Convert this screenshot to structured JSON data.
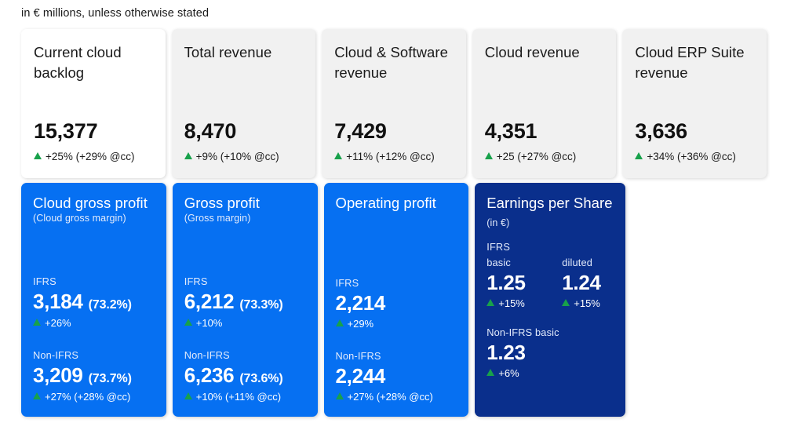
{
  "page": {
    "note": "in € millions, unless otherwise stated"
  },
  "colors": {
    "blue": "#0670f2",
    "navy": "#0a2f8c",
    "grey_card": "#f1f1f1",
    "white_card": "#ffffff",
    "up_green": "#18a14b"
  },
  "icons": {
    "up_triangle": "triangle-up-icon"
  },
  "top_cards": [
    {
      "title": "Current cloud backlog",
      "value": "15,377",
      "delta": "+25% (+29% @cc)",
      "background": "white"
    },
    {
      "title": "Total revenue",
      "value": "8,470",
      "delta": "+9% (+10% @cc)",
      "background": "grey"
    },
    {
      "title": "Cloud & Software revenue",
      "value": "7,429",
      "delta": "+11% (+12% @cc)",
      "background": "grey"
    },
    {
      "title": "Cloud revenue",
      "value": "4,351",
      "delta": "+25 (+27% @cc)",
      "background": "grey"
    },
    {
      "title": "Cloud ERP Suite revenue",
      "value": "3,636",
      "delta": "+34% (+36% @cc)",
      "background": "grey"
    }
  ],
  "bottom_cards": [
    {
      "title": "Cloud gross profit",
      "subtitle": "(Cloud gross margin)",
      "ifrs_label": "IFRS",
      "ifrs_value": "3,184",
      "ifrs_pct": "(73.2%)",
      "ifrs_delta": "+26%",
      "nonifrs_label": "Non-IFRS",
      "nonifrs_value": "3,209",
      "nonifrs_pct": "(73.7%)",
      "nonifrs_delta": "+27% (+28% @cc)"
    },
    {
      "title": "Gross profit",
      "subtitle": "(Gross margin)",
      "ifrs_label": "IFRS",
      "ifrs_value": "6,212",
      "ifrs_pct": "(73.3%)",
      "ifrs_delta": "+10%",
      "nonifrs_label": "Non-IFRS",
      "nonifrs_value": "6,236",
      "nonifrs_pct": "(73.6%)",
      "nonifrs_delta": "+10% (+11% @cc)"
    },
    {
      "title": "Operating profit",
      "subtitle": "",
      "ifrs_label": "IFRS",
      "ifrs_value": "2,214",
      "ifrs_pct": "",
      "ifrs_delta": "+29%",
      "nonifrs_label": "Non-IFRS",
      "nonifrs_value": "2,244",
      "nonifrs_pct": "",
      "nonifrs_delta": "+27% (+28% @cc)"
    }
  ],
  "eps_card": {
    "title": "Earnings per Share",
    "unit": "(in €)",
    "ifrs_label": "IFRS",
    "basic_label": "basic",
    "diluted_label": "diluted",
    "basic_value": "1.25",
    "basic_delta": "+15%",
    "diluted_value": "1.24",
    "diluted_delta": "+15%",
    "nonifrs_label": "Non-IFRS basic",
    "nonifrs_value": "1.23",
    "nonifrs_delta": "+6%"
  }
}
